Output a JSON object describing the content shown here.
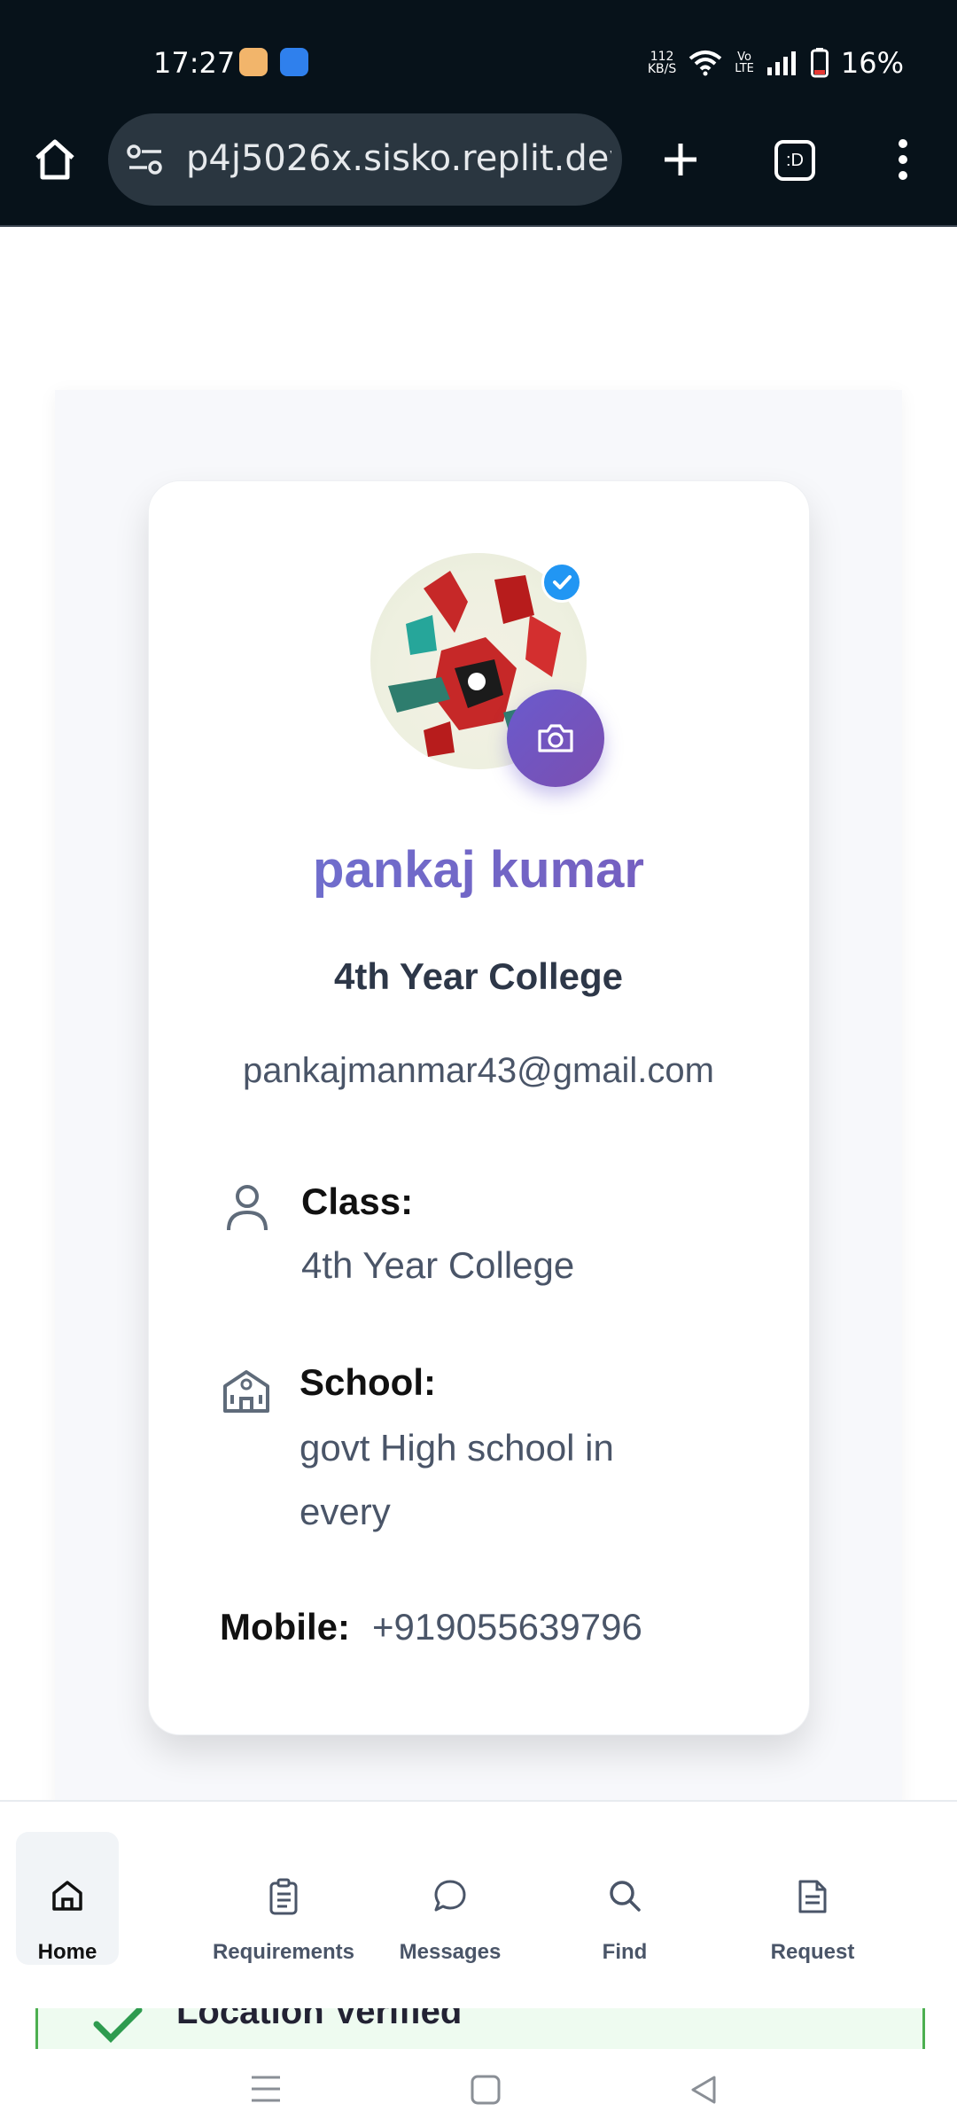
{
  "status_bar": {
    "time": "17:27",
    "speed_top": "112",
    "speed_bottom": "KB/S",
    "volte_top": "Vo",
    "volte_bottom": "LTE",
    "battery": "16%"
  },
  "browser": {
    "url": "p4j5026x.sisko.replit.dev",
    "tab_label": ":D"
  },
  "profile": {
    "name": "pankaj kumar",
    "subtitle": "4th Year College",
    "email": "pankajmanmar43@gmail.com",
    "class_label": "Class:",
    "class_value": "4th Year College",
    "school_label": "School:",
    "school_value_line1": "govt High school in",
    "school_value_line2": "every",
    "mobile_label": "Mobile:",
    "mobile_value": "+919055639796"
  },
  "nav": {
    "items": [
      {
        "label": "Home",
        "icon": "home-icon"
      },
      {
        "label": "Requirements",
        "icon": "clipboard-icon"
      },
      {
        "label": "Messages",
        "icon": "chat-bubble-icon"
      },
      {
        "label": "Find",
        "icon": "search-icon"
      },
      {
        "label": "Request",
        "icon": "document-icon"
      }
    ]
  },
  "peek": {
    "text": "Location Verified"
  },
  "colors": {
    "accent": "#6a5acd",
    "name_gradient_start": "#6a7bd8",
    "name_gradient_end": "#7a52b5",
    "verified": "#2196f3"
  }
}
